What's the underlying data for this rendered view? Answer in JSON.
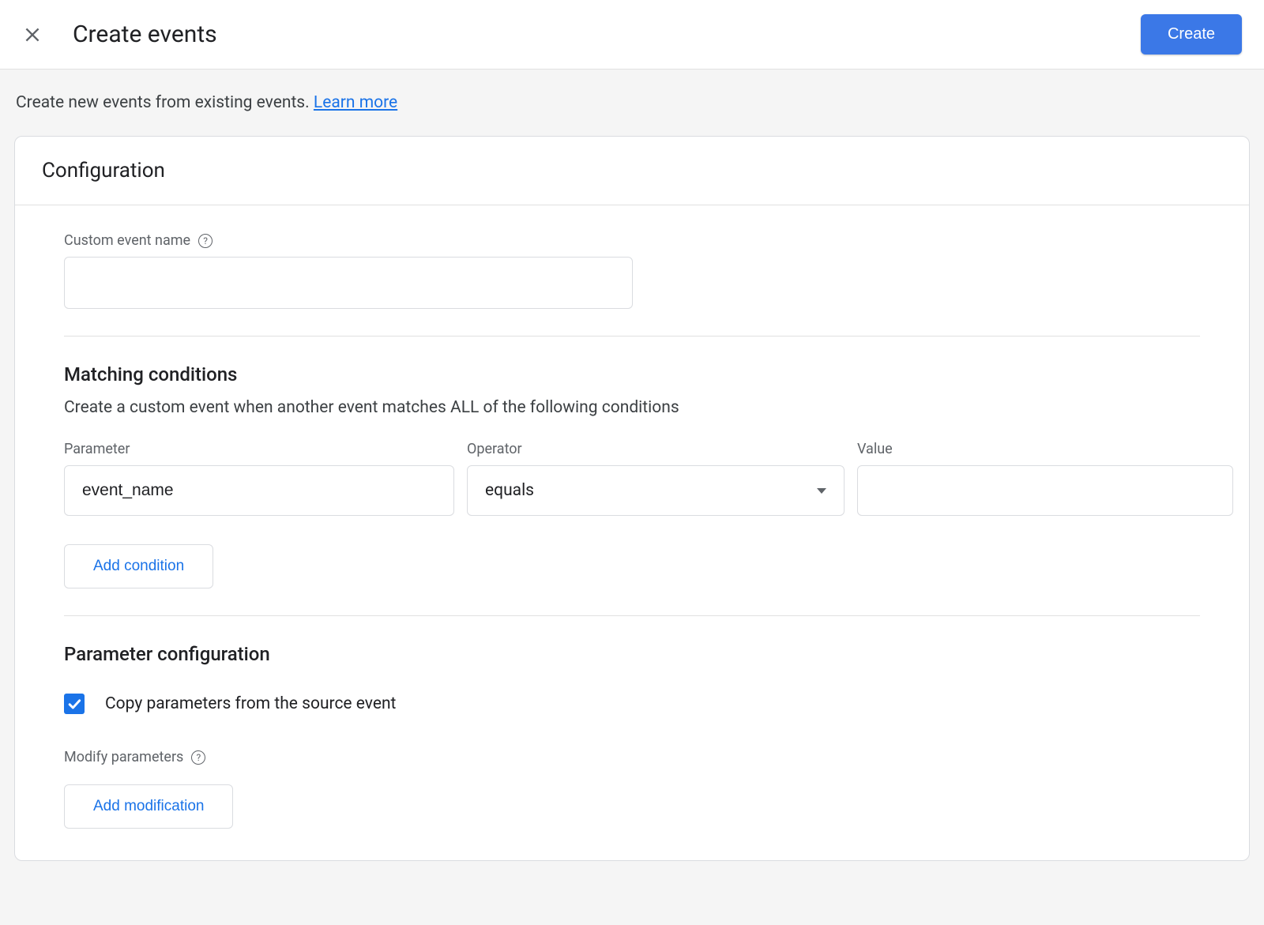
{
  "header": {
    "title": "Create events",
    "create_button": "Create"
  },
  "subheader": {
    "text_prefix": "Create new events from existing events. ",
    "learn_more": "Learn more"
  },
  "card": {
    "title": "Configuration",
    "custom_event_name": {
      "label": "Custom event name",
      "value": ""
    },
    "matching": {
      "title": "Matching conditions",
      "description": "Create a custom event when another event matches ALL of the following conditions",
      "parameter_label": "Parameter",
      "operator_label": "Operator",
      "value_label": "Value",
      "condition": {
        "parameter": "event_name",
        "operator": "equals",
        "value": ""
      },
      "add_condition": "Add condition"
    },
    "param_config": {
      "title": "Parameter configuration",
      "copy_params_label": "Copy parameters from the source event",
      "copy_params_checked": true,
      "modify_label": "Modify parameters",
      "add_modification": "Add modification"
    }
  }
}
